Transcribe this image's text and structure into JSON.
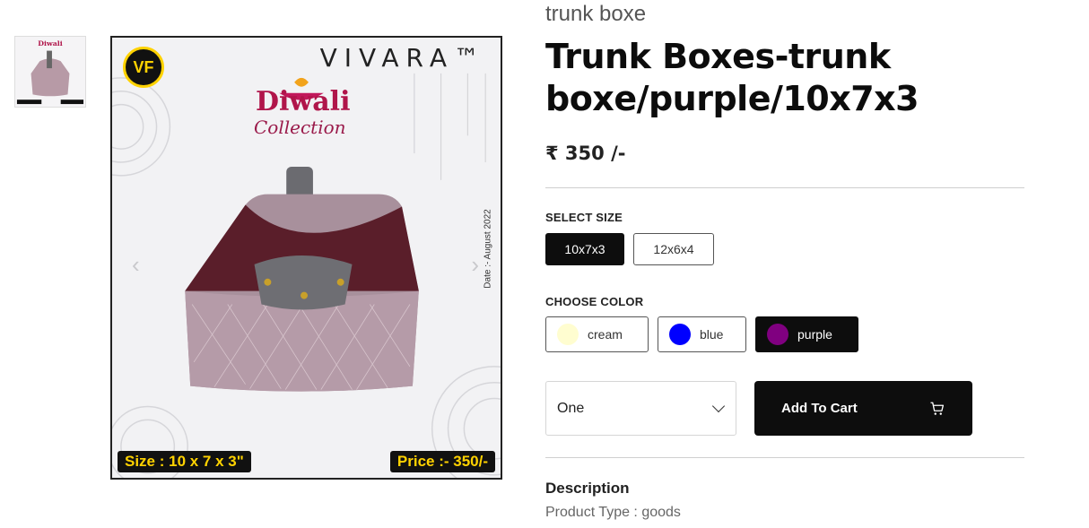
{
  "product": {
    "category": "trunk boxe",
    "title": "Trunk Boxes-trunk boxe/purple/10x7x3",
    "price": "₹ 350 /-"
  },
  "image": {
    "brand": "VIVARA™",
    "collection_title": "Diwali",
    "collection_sub": "Collection",
    "date": "Date :- August 2022",
    "size_label": "Size : 10 x 7 x 3\"",
    "price_label": "Price :- 350/-",
    "logo_text": "VF"
  },
  "size": {
    "label": "SELECT SIZE",
    "options": [
      "10x7x3",
      "12x6x4"
    ],
    "selected": "10x7x3"
  },
  "color": {
    "label": "CHOOSE COLOR",
    "options": [
      {
        "name": "cream",
        "hex": "#fffdd0"
      },
      {
        "name": "blue",
        "hex": "#0000ff"
      },
      {
        "name": "purple",
        "hex": "#800080"
      }
    ],
    "selected": "purple"
  },
  "quantity": {
    "value": "One"
  },
  "cart": {
    "label": "Add To Cart",
    "icon": "cart-icon"
  },
  "description": {
    "heading": "Description",
    "text": "Product Type : goods"
  },
  "colors": {
    "primary": "#0d0d0d",
    "accent_yellow": "#ffd200"
  }
}
